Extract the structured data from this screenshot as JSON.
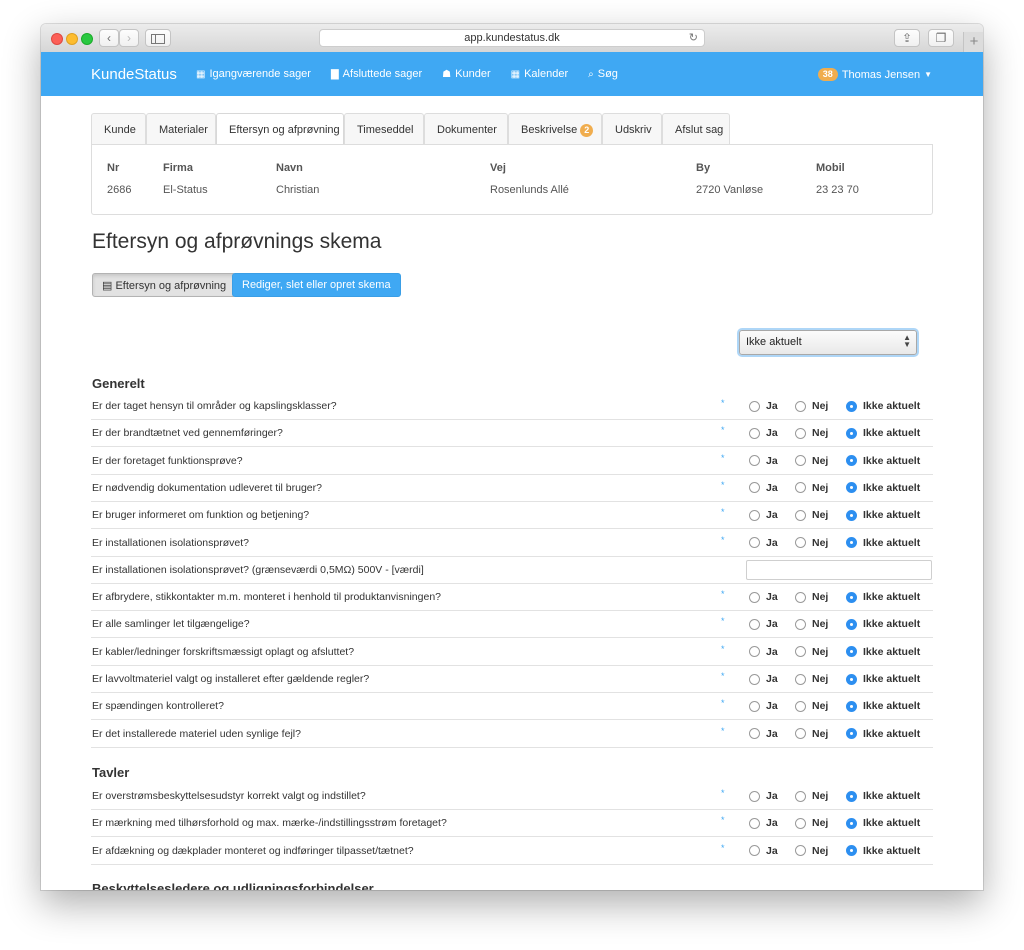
{
  "browser": {
    "url": "app.kundestatus.dk"
  },
  "app": {
    "brand": "KundeStatus",
    "menu": [
      {
        "icon": "▦",
        "label": "Igangværende sager"
      },
      {
        "icon": "▇",
        "label": "Afsluttede sager"
      },
      {
        "icon": "☗",
        "label": "Kunder"
      },
      {
        "icon": "▦",
        "label": "Kalender"
      },
      {
        "icon": "⌕",
        "label": "Søg"
      }
    ],
    "user": {
      "badge": "38",
      "name": "Thomas Jensen"
    }
  },
  "tabs": [
    {
      "label": "Kunde"
    },
    {
      "label": "Materialer"
    },
    {
      "label": "Eftersyn og afprøvning",
      "active": true
    },
    {
      "label": "Timeseddel"
    },
    {
      "label": "Dokumenter"
    },
    {
      "label": "Beskrivelse",
      "badge": "2"
    },
    {
      "label": "Udskriv"
    },
    {
      "label": "Afslut sag"
    }
  ],
  "info": {
    "headers": [
      "Nr",
      "Firma",
      "Navn",
      "Vej",
      "By",
      "Mobil"
    ],
    "values": [
      "2686",
      "El-Status",
      "Christian",
      "Rosenlunds Allé",
      "2720 Vanløse",
      "23 23 70"
    ]
  },
  "page": {
    "title": "Eftersyn og afprøvnings skema",
    "btn_view": "Eftersyn og afprøvning",
    "btn_edit": "Rediger, slet eller opret skema",
    "select_value": "Ikke aktuelt"
  },
  "options": {
    "yes": "Ja",
    "no": "Nej",
    "na": "Ikke aktuelt"
  },
  "required_mark": "*",
  "sections": [
    {
      "title": "Generelt",
      "questions": [
        {
          "text": "Er der taget hensyn til områder og kapslingsklasser?",
          "answer": "na"
        },
        {
          "text": "Er der brandtætnet ved gennemføringer?",
          "answer": "na"
        },
        {
          "text": "Er der foretaget funktionsprøve?",
          "answer": "na"
        },
        {
          "text": "Er nødvendig dokumentation udleveret til bruger?",
          "answer": "na"
        },
        {
          "text": "Er bruger informeret om funktion og betjening?",
          "answer": "na"
        },
        {
          "text": "Er installationen isolationsprøvet?",
          "answer": "na"
        },
        {
          "text": "Er installationen isolationsprøvet? (grænseværdi 0,5MΩ) 500V - [værdi]",
          "type": "input",
          "value": ""
        },
        {
          "text": "Er afbrydere, stikkontakter m.m. monteret i henhold til produktanvisningen?",
          "answer": "na"
        },
        {
          "text": "Er alle samlinger let tilgængelige?",
          "answer": "na"
        },
        {
          "text": "Er kabler/ledninger forskriftsmæssigt oplagt og afsluttet?",
          "answer": "na"
        },
        {
          "text": "Er lavvoltmateriel valgt og installeret efter gældende regler?",
          "answer": "na"
        },
        {
          "text": "Er spændingen kontrolleret?",
          "answer": "na"
        },
        {
          "text": "Er det installerede materiel uden synlige fejl?",
          "answer": "na"
        }
      ]
    },
    {
      "title": "Tavler",
      "questions": [
        {
          "text": "Er overstrømsbeskyttelsesudstyr korrekt valgt og indstillet?",
          "answer": "na"
        },
        {
          "text": "Er mærkning med tilhørsforhold og max. mærke-/indstillingsstrøm foretaget?",
          "answer": "na"
        },
        {
          "text": "Er afdækning og dækplader monteret og indføringer tilpasset/tætnet?",
          "answer": "na"
        }
      ]
    },
    {
      "title": "Beskyttelsesledere og udligningsforbindelser",
      "questions": []
    }
  ]
}
